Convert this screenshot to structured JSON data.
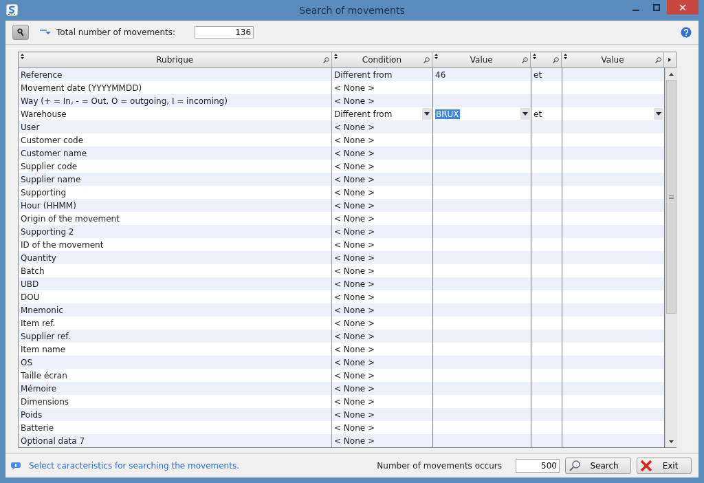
{
  "window": {
    "title": "Search of movements"
  },
  "toolbar": {
    "total_label": "Total number of movements:",
    "total_value": "136"
  },
  "table": {
    "columns": [
      {
        "label": "Rubrique"
      },
      {
        "label": "Condition"
      },
      {
        "label": "Value"
      },
      {},
      {
        "label": "Value"
      }
    ],
    "rows": [
      {
        "rubrique": "Reference",
        "condition": "Different from",
        "value": "46",
        "link": "et",
        "editing": false
      },
      {
        "rubrique": "Movement date (YYYYMMDD)",
        "condition": "< None >",
        "value": "",
        "link": "",
        "editing": false
      },
      {
        "rubrique": "Way (+ = In, - = Out, O = outgoing, I = incoming)",
        "condition": "< None >",
        "value": "",
        "link": "",
        "editing": false
      },
      {
        "rubrique": "Warehouse",
        "condition": "Different from",
        "value": "BRUX",
        "link": "et",
        "editing": true
      },
      {
        "rubrique": "User",
        "condition": "< None >",
        "value": "",
        "link": "",
        "editing": false
      },
      {
        "rubrique": "Customer code",
        "condition": "< None >",
        "value": "",
        "link": "",
        "editing": false
      },
      {
        "rubrique": "Customer name",
        "condition": "< None >",
        "value": "",
        "link": "",
        "editing": false
      },
      {
        "rubrique": "Supplier code",
        "condition": "< None >",
        "value": "",
        "link": "",
        "editing": false
      },
      {
        "rubrique": "Supplier name",
        "condition": "< None >",
        "value": "",
        "link": "",
        "editing": false
      },
      {
        "rubrique": "Supporting",
        "condition": "< None >",
        "value": "",
        "link": "",
        "editing": false
      },
      {
        "rubrique": "Hour (HHMM)",
        "condition": "< None >",
        "value": "",
        "link": "",
        "editing": false
      },
      {
        "rubrique": "Origin of the movement",
        "condition": "< None >",
        "value": "",
        "link": "",
        "editing": false
      },
      {
        "rubrique": "Supporting 2",
        "condition": "< None >",
        "value": "",
        "link": "",
        "editing": false
      },
      {
        "rubrique": "ID of the movement",
        "condition": "< None >",
        "value": "",
        "link": "",
        "editing": false
      },
      {
        "rubrique": "Quantity",
        "condition": "< None >",
        "value": "",
        "link": "",
        "editing": false
      },
      {
        "rubrique": "Batch",
        "condition": "< None >",
        "value": "",
        "link": "",
        "editing": false
      },
      {
        "rubrique": "UBD",
        "condition": "< None >",
        "value": "",
        "link": "",
        "editing": false
      },
      {
        "rubrique": "DOU",
        "condition": "< None >",
        "value": "",
        "link": "",
        "editing": false
      },
      {
        "rubrique": "Mnemonic",
        "condition": "< None >",
        "value": "",
        "link": "",
        "editing": false
      },
      {
        "rubrique": "Item ref.",
        "condition": "< None >",
        "value": "",
        "link": "",
        "editing": false
      },
      {
        "rubrique": "Supplier ref.",
        "condition": "< None >",
        "value": "",
        "link": "",
        "editing": false
      },
      {
        "rubrique": "Item name",
        "condition": "< None >",
        "value": "",
        "link": "",
        "editing": false
      },
      {
        "rubrique": "OS",
        "condition": "< None >",
        "value": "",
        "link": "",
        "editing": false
      },
      {
        "rubrique": "Taille écran",
        "condition": "< None >",
        "value": "",
        "link": "",
        "editing": false
      },
      {
        "rubrique": "Mémoire",
        "condition": "< None >",
        "value": "",
        "link": "",
        "editing": false
      },
      {
        "rubrique": "Dimensions",
        "condition": "< None >",
        "value": "",
        "link": "",
        "editing": false
      },
      {
        "rubrique": "Poids",
        "condition": "< None >",
        "value": "",
        "link": "",
        "editing": false
      },
      {
        "rubrique": "Batterie",
        "condition": "< None >",
        "value": "",
        "link": "",
        "editing": false
      },
      {
        "rubrique": "Optional data 7",
        "condition": "< None >",
        "value": "",
        "link": "",
        "editing": false
      }
    ]
  },
  "footer": {
    "hint": "Select caracteristics for searching the movements.",
    "count_label": "Number of movements occurs",
    "count_value": "500",
    "buttons": [
      {
        "kind": "search",
        "label": "Search"
      },
      {
        "kind": "exit",
        "label": "Exit"
      }
    ]
  }
}
